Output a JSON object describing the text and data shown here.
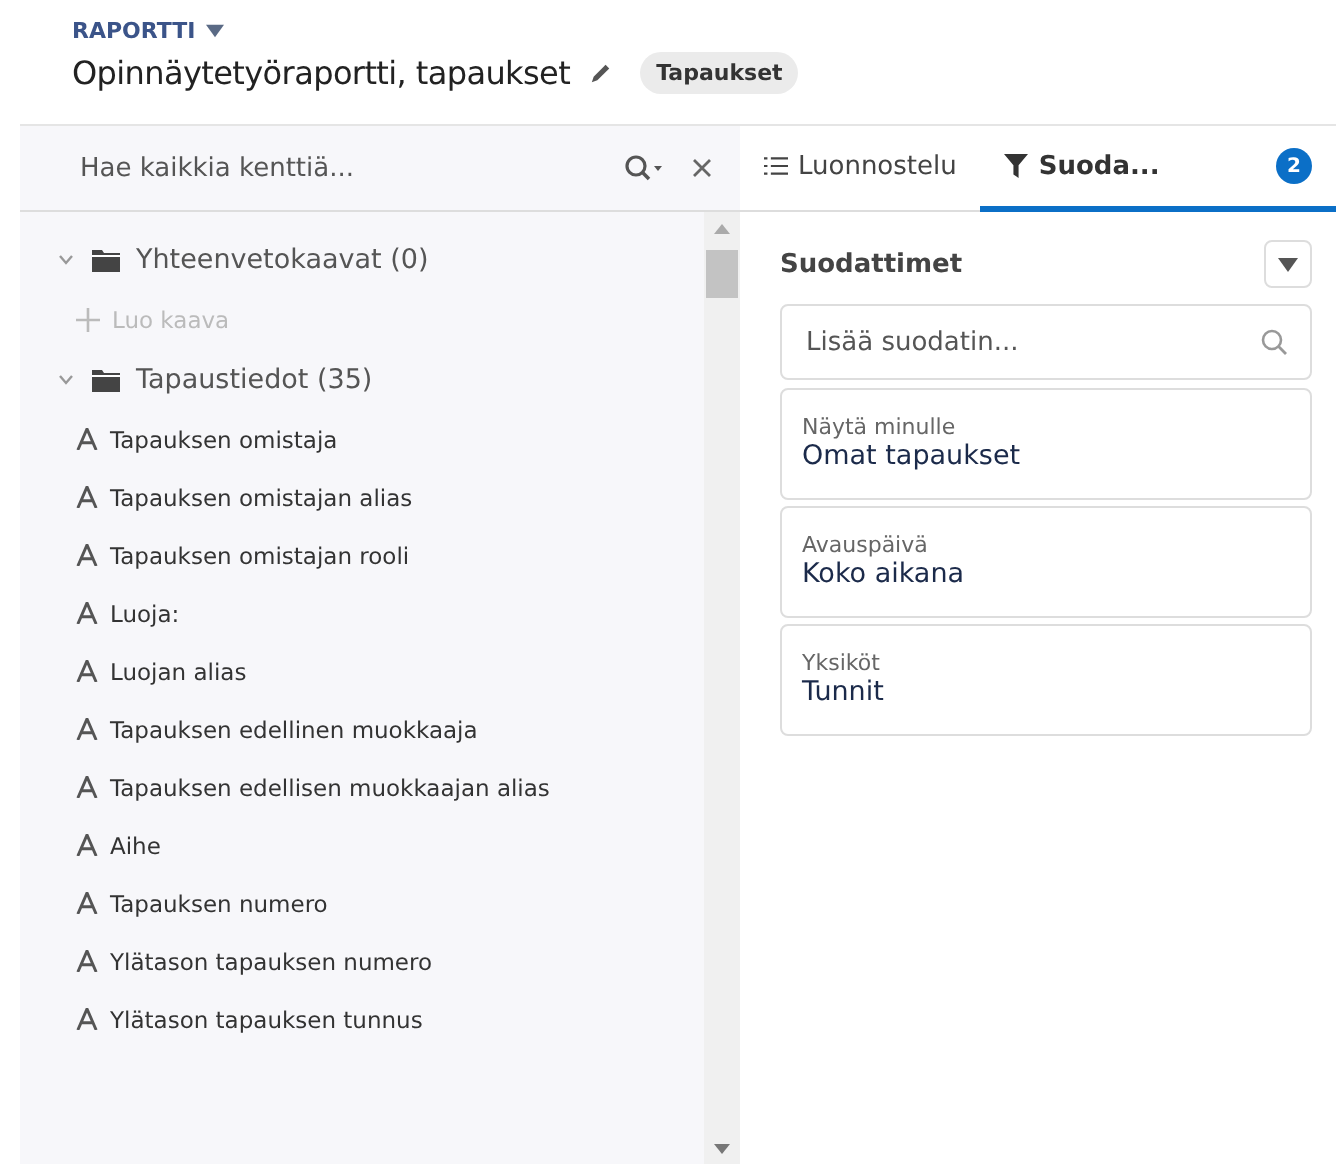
{
  "header": {
    "eyebrow": "RAPORTTI",
    "title": "Opinnäytetyöraportti, tapaukset",
    "badge": "Tapaukset"
  },
  "field_search": {
    "placeholder": "Hae kaikkia kenttiä..."
  },
  "tree": [
    {
      "label": "Yhteenvetokaavat (0)",
      "expanded": true,
      "children": [
        {
          "kind": "action",
          "label": "Luo kaava"
        }
      ]
    },
    {
      "label": "Tapaustiedot (35)",
      "expanded": true,
      "children": [
        {
          "kind": "field",
          "label": "Tapauksen omistaja"
        },
        {
          "kind": "field",
          "label": "Tapauksen omistajan alias"
        },
        {
          "kind": "field",
          "label": "Tapauksen omistajan rooli"
        },
        {
          "kind": "field",
          "label": "Luoja:"
        },
        {
          "kind": "field",
          "label": "Luojan alias"
        },
        {
          "kind": "field",
          "label": "Tapauksen edellinen muokkaaja"
        },
        {
          "kind": "field",
          "label": "Tapauksen edellisen muokkaajan alias"
        },
        {
          "kind": "field",
          "label": "Aihe"
        },
        {
          "kind": "field",
          "label": "Tapauksen numero"
        },
        {
          "kind": "field",
          "label": "Ylätason tapauksen numero"
        },
        {
          "kind": "field",
          "label": "Ylätason tapauksen tunnus"
        }
      ]
    }
  ],
  "tabs": [
    {
      "kind": "list",
      "label": "Luonnostelu",
      "selected": false
    },
    {
      "kind": "filter",
      "label": "Suoda...",
      "count": "2",
      "selected": true
    }
  ],
  "filters_title": "Suodattimet",
  "filter_search": {
    "placeholder": "Lisää suodatin..."
  },
  "filters": [
    {
      "label": "Näytä minulle",
      "value": "Omat tapaukset"
    },
    {
      "label": "Avauspäivä",
      "value": "Koko aikana"
    },
    {
      "label": "Yksiköt",
      "value": "Tunnit"
    }
  ]
}
